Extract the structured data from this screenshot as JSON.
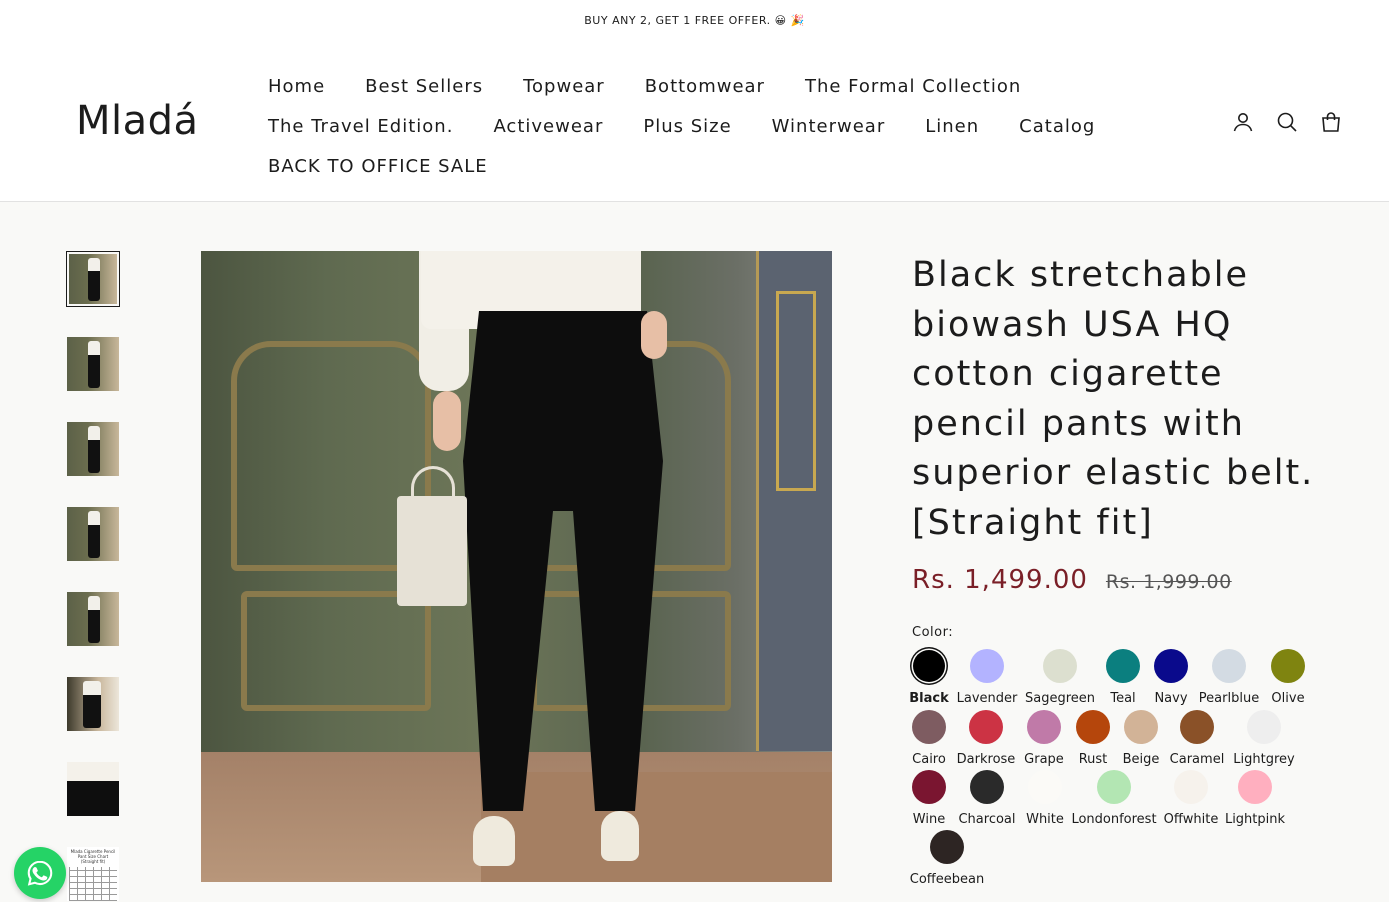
{
  "announcement": "BUY ANY 2, GET 1 FREE OFFER. 😀 🎉",
  "header": {
    "logo": "Mladá",
    "nav_rows": [
      [
        "Home",
        "Best Sellers",
        "Topwear",
        "Bottomwear",
        "The Formal Collection"
      ],
      [
        "The Travel Edition.",
        "Activewear",
        "Plus Size",
        "Winterwear",
        "Linen",
        "Catalog"
      ],
      [
        "BACK TO OFFICE SALE"
      ]
    ],
    "icons": [
      "account-icon",
      "search-icon",
      "cart-icon"
    ]
  },
  "gallery": {
    "thumbnail_count": 8,
    "active_index": 0,
    "size_chart_thumb_title": "Mlada Cigarette Pencil Pant Size Chart (Straight fit)"
  },
  "product": {
    "title": "Black stretchable biowash USA HQ cotton cigarette pencil pants with superior elastic belt. [Straight fit]",
    "price": "Rs. 1,499.00",
    "compare_price": "Rs. 1,999.00",
    "color_label": "Color:",
    "selected_color": "Black",
    "colors": [
      {
        "name": "Black",
        "hex": "#000000"
      },
      {
        "name": "Lavender",
        "hex": "#b3b3ff"
      },
      {
        "name": "Sagegreen",
        "hex": "#dcdfcf"
      },
      {
        "name": "Teal",
        "hex": "#0b7f7f"
      },
      {
        "name": "Navy",
        "hex": "#0a0a8c"
      },
      {
        "name": "Pearlblue",
        "hex": "#d3dbe3"
      },
      {
        "name": "Olive",
        "hex": "#7f8410"
      },
      {
        "name": "Cairo",
        "hex": "#7e5c61"
      },
      {
        "name": "Darkrose",
        "hex": "#cc3344"
      },
      {
        "name": "Grape",
        "hex": "#c07aa8"
      },
      {
        "name": "Rust",
        "hex": "#b5460c"
      },
      {
        "name": "Beige",
        "hex": "#d2b397"
      },
      {
        "name": "Caramel",
        "hex": "#8a5128"
      },
      {
        "name": "Lightgrey",
        "hex": "#eeeeee"
      },
      {
        "name": "Wine",
        "hex": "#7a1530"
      },
      {
        "name": "Charcoal",
        "hex": "#2a2a2a"
      },
      {
        "name": "White",
        "hex": "#fbfaf7"
      },
      {
        "name": "Londonforest",
        "hex": "#b3e6b3"
      },
      {
        "name": "Offwhite",
        "hex": "#f6f2ec"
      },
      {
        "name": "Lightpink",
        "hex": "#ffafbf"
      },
      {
        "name": "Coffeebean",
        "hex": "#2d2523"
      }
    ]
  },
  "colors": {
    "price": "#7a1f27",
    "whatsapp": "#25d366"
  }
}
